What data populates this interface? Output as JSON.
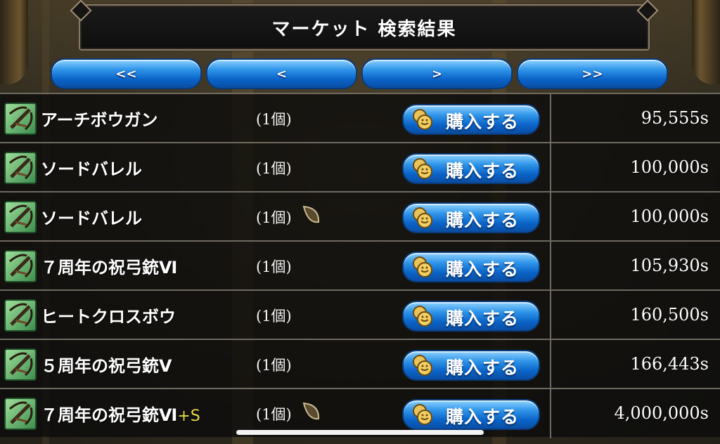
{
  "title": "マーケット 検索結果",
  "pagination": [
    "<<",
    "<",
    ">",
    ">>"
  ],
  "buy_label": "購入する",
  "rows": [
    {
      "name": "アーチボウガン",
      "suffix": "",
      "qty": "(1個)",
      "seed": false,
      "price": "95,555s"
    },
    {
      "name": "ソードバレル",
      "suffix": "",
      "qty": "(1個)",
      "seed": false,
      "price": "100,000s"
    },
    {
      "name": "ソードバレル",
      "suffix": "",
      "qty": "(1個)",
      "seed": true,
      "price": "100,000s"
    },
    {
      "name": "７周年の祝弓銃Ⅵ",
      "suffix": "",
      "qty": "(1個)",
      "seed": false,
      "price": "105,930s"
    },
    {
      "name": "ヒートクロスボウ",
      "suffix": "",
      "qty": "(1個)",
      "seed": false,
      "price": "160,500s"
    },
    {
      "name": "５周年の祝弓銃Ⅴ",
      "suffix": "",
      "qty": "(1個)",
      "seed": false,
      "price": "166,443s"
    },
    {
      "name": "７周年の祝弓銃Ⅵ",
      "suffix": "+S",
      "qty": "(1個)",
      "seed": true,
      "price": "4,000,000s"
    }
  ],
  "colors": {
    "button_blue": "#2f95e9",
    "suffix_yellow": "#e9dc4a",
    "icon_green": "#9ddf9a"
  },
  "icons": {
    "item": "crossbow-icon",
    "seed": "seed-icon",
    "buy": "coin-icon"
  }
}
